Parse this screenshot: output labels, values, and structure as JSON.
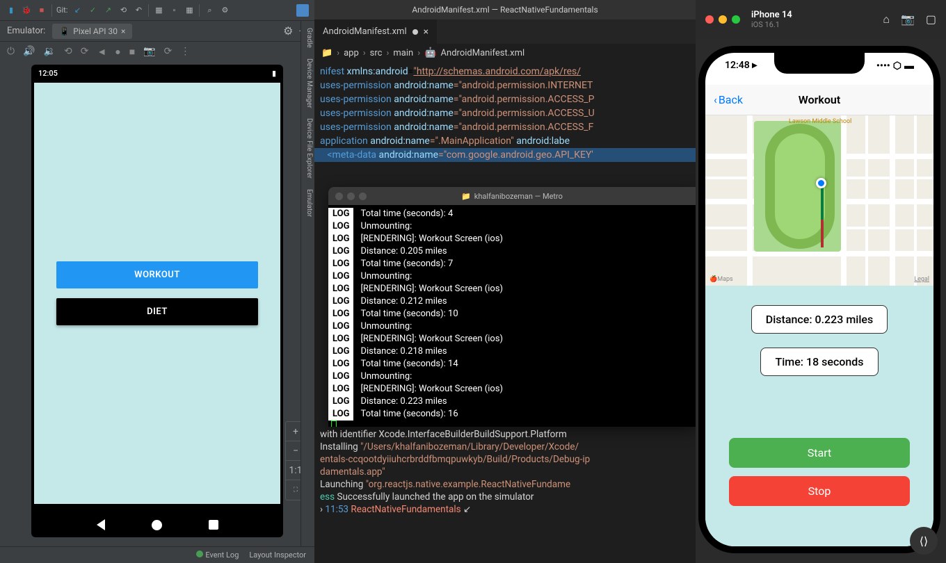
{
  "androidStudio": {
    "gitLabel": "Git:",
    "emulatorLabel": "Emulator:",
    "deviceTab": "Pixel API 30",
    "statusTime": "12:05",
    "workoutBtn": "WORKOUT",
    "dietBtn": "DIET",
    "zoom": {
      "plus": "+",
      "minus": "−",
      "fit": "1:1"
    },
    "eventLog": "Event Log",
    "layoutInspector": "Layout Inspector",
    "rail": {
      "gradle": "Gradle",
      "deviceManager": "Device Manager",
      "fileExplorer": "Device File Explorer",
      "emulator": "Emulator"
    }
  },
  "editor": {
    "windowTitle": "AndroidManifest.xml — ReactNativeFundamentals",
    "tab": "AndroidManifest.xml",
    "tabMod": "M",
    "breadcrumb": {
      "app": "app",
      "src": "src",
      "main": "main",
      "file": "AndroidManifest.xml"
    },
    "code": {
      "l1a": "nifest ",
      "l1b": "xmlns:android",
      "l1c": "=",
      "l1d": "\"http://schemas.android.com/apk/res/",
      "l2a": "uses-permission ",
      "l2b": "android:name",
      "l2c": "=\"android.permission.INTERNET",
      "l3": "=\"android.permission.ACCESS_P",
      "l4": "=\"android.permission.ACCESS_U",
      "l5": "=\"android.permission.ACCESS_F",
      "l6a": "application ",
      "l6b": "android:name",
      "l6c": "=\".MainApplication\" ",
      "l6d": "android:labe",
      "l7a": "<",
      "l7b": "meta-data ",
      "l7c": "android:name",
      "l7d": "=\"com.google.android.geo.API_KEY'"
    },
    "terminal": {
      "title": "khalfanibozeman — Metro",
      "lines": [
        "Total time (seconds): 4",
        "Unmounting:",
        "[RENDERING]: Workout Screen (ios)",
        "Distance: 0.205 miles",
        "Total time (seconds): 7",
        "Unmounting:",
        "[RENDERING]: Workout Screen (ios)",
        "Distance: 0.212 miles",
        "Total time (seconds): 10",
        "Unmounting:",
        "[RENDERING]: Workout Screen (ios)",
        "Distance: 0.218 miles",
        "Total time (seconds): 14",
        "Unmounting:",
        "[RENDERING]: Workout Screen (ios)",
        "Distance: 0.223 miles",
        "Total time (seconds): 16"
      ]
    },
    "bottom": {
      "l1": " with identifier Xcode.InterfaceBuilderBuildSupport.Platform",
      "l2a": "Installing ",
      "l2b": "\"/Users/khalfanibozeman/Library/Developer/Xcode/",
      "l3": "entals-ccqootdyiiuhcrbrddfbmqpuwkyb/Build/Products/Debug-ip",
      "l4": "damentals.app\"",
      "l5a": "Launching ",
      "l5b": "\"org.reactjs.native.example.ReactNativeFundame",
      "l6a": "ess",
      " l6b": " Successfully launched the app on the simulator",
      "l7a": "› ",
      "l7b": "11:53 ",
      "l7c": "ReactNativeFundamentals",
      " l7d": " ↙"
    }
  },
  "ios": {
    "device": "iPhone 14",
    "os": "iOS 16.1",
    "time": "12:48",
    "timeIcon": "▸",
    "back": "Back",
    "navTitle": "Workout",
    "school": "Lawson Middle School",
    "maps": "🍎Maps",
    "legal": "Legal",
    "distance": "Distance: 0.223 miles",
    "timeLabel": "Time: 18 seconds",
    "start": "Start",
    "stop": "Stop"
  }
}
